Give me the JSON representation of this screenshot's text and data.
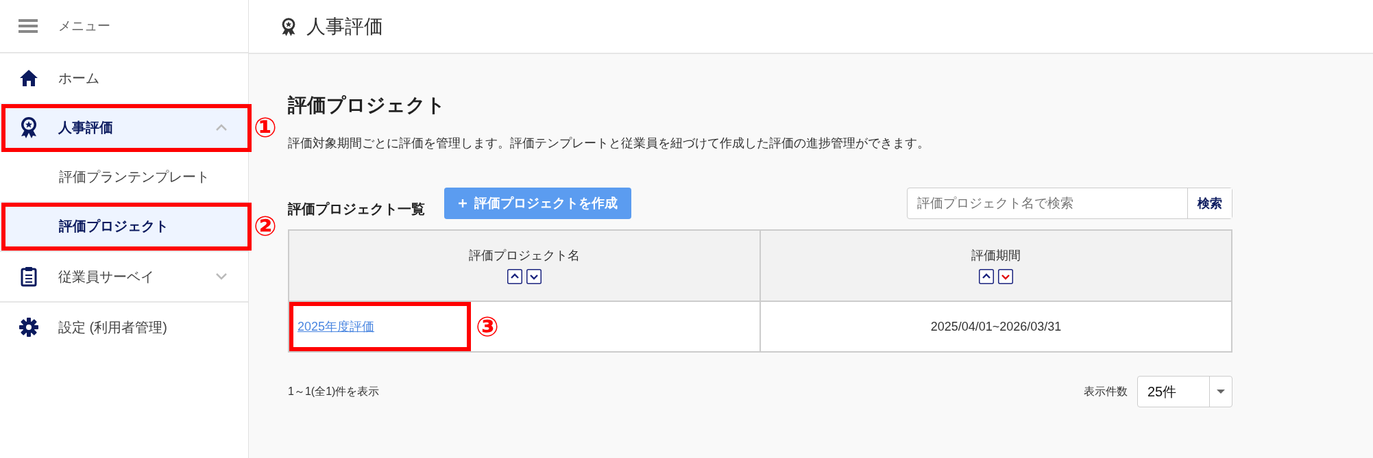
{
  "header": {
    "title": "人事評価"
  },
  "sidebar": {
    "menu_label": "メニュー",
    "items": [
      {
        "label": "ホーム",
        "selected": false
      },
      {
        "label": "人事評価",
        "selected": true,
        "expanded": true,
        "annotation": "①",
        "children": [
          {
            "label": "評価プランテンプレート",
            "selected": false
          },
          {
            "label": "評価プロジェクト",
            "selected": true,
            "annotation": "②"
          }
        ]
      },
      {
        "label": "従業員サーベイ",
        "selected": false,
        "expanded": false
      },
      {
        "label": "設定 (利用者管理)",
        "selected": false
      }
    ]
  },
  "main": {
    "heading": "評価プロジェクト",
    "description": "評価対象期間ごとに評価を管理します。評価テンプレートと従業員を紐づけて作成した評価の進捗管理ができます。",
    "list_title": "評価プロジェクト一覧",
    "create_button": "評価プロジェクトを作成",
    "search": {
      "placeholder": "評価プロジェクト名で検索",
      "button": "検索"
    },
    "table": {
      "columns": [
        {
          "label": "評価プロジェクト名",
          "sorted_desc": false
        },
        {
          "label": "評価期間",
          "sorted_desc": true
        }
      ],
      "rows": [
        {
          "name": "2025年度評価",
          "period": "2025/04/01~2026/03/31",
          "annotation": "③"
        }
      ]
    },
    "summary": "1～1(全1)件を表示",
    "page_size": {
      "label": "表示件数",
      "value": "25件"
    }
  }
}
